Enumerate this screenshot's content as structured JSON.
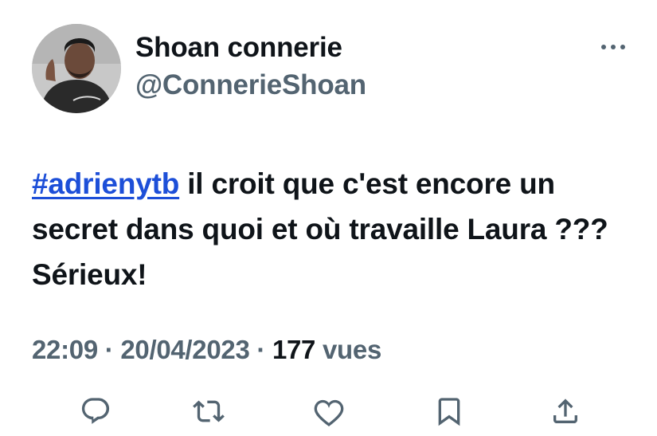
{
  "author": {
    "display_name": "Shoan connerie",
    "handle": "@ConnerieShoan",
    "avatar_icon": "avatar-photo"
  },
  "tweet": {
    "hashtag": "#adrienytb",
    "text": " il croit que c'est encore un secret dans quoi et où travaille Laura ??? Sérieux!"
  },
  "meta": {
    "time": "22:09",
    "separator": " · ",
    "date": "20/04/2023",
    "views_count": "177",
    "views_label": " vues"
  },
  "actions": [
    "reply-icon",
    "retweet-icon",
    "like-icon",
    "bookmark-icon",
    "share-icon"
  ],
  "colors": {
    "text": "#0f1419",
    "secondary": "#536471",
    "link": "#1d4fd8"
  }
}
